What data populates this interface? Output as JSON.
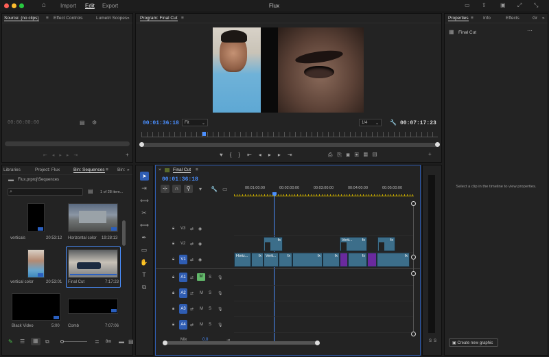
{
  "window": {
    "title": "Flux"
  },
  "topmenu": {
    "import": "Import",
    "edit": "Edit",
    "export": "Export"
  },
  "source": {
    "tab": "Source: (no clips)",
    "tab2": "Effect Controls",
    "tab3": "Lumetri Scopes",
    "timecode": "00:00:00:00"
  },
  "program": {
    "tab": "Program: Final Cut",
    "timecode": "00:01:36:18",
    "fit": "Fit",
    "ratio": "1/4",
    "duration": "00:07:17:23"
  },
  "properties": {
    "tab": "Properties",
    "tab2": "Info",
    "tab3": "Effects",
    "tab4": "Gr",
    "item": "Final Cut",
    "hint": "Select a clip in the timeline to view properties.",
    "create_btn": "Create new graphic"
  },
  "project": {
    "tab1": "Libraries",
    "tab2": "Project: Flux",
    "tab3": "Bin: Sequences",
    "tab4": "Bin:",
    "path": "Flux.prproj\\Sequences",
    "count": "1 of 28 item...",
    "items": [
      {
        "name": "verticals",
        "dur": "20:53:12"
      },
      {
        "name": "Horizontal color",
        "dur": "19:28:13"
      },
      {
        "name": "vertical color",
        "dur": "20:53:01"
      },
      {
        "name": "Final Cut",
        "dur": "7:17:23"
      },
      {
        "name": "Black Video",
        "dur": "5:00"
      },
      {
        "name": "Comb",
        "dur": "7:07:06"
      }
    ],
    "zoom": "8m"
  },
  "timeline": {
    "tab": "Final Cut",
    "timecode": "00:01:36:18",
    "ruler": [
      "00:01:00:00",
      "00:02:00:00",
      "00:03:00:00",
      "00:04:00:00",
      "00:05:00:00"
    ],
    "tracks": {
      "v3": "V3",
      "v2": "V2",
      "v1": "V1",
      "a1": "A1",
      "a2": "A2",
      "a3": "A3",
      "a4": "A4",
      "mix": "Mix",
      "mixval": "0.0"
    },
    "clips": {
      "fx": "fx",
      "hori": "Horiz...",
      "verti": "Verti...",
      "m": "M",
      "s": "S"
    }
  },
  "meter": {
    "s1": "S",
    "s2": "S"
  }
}
